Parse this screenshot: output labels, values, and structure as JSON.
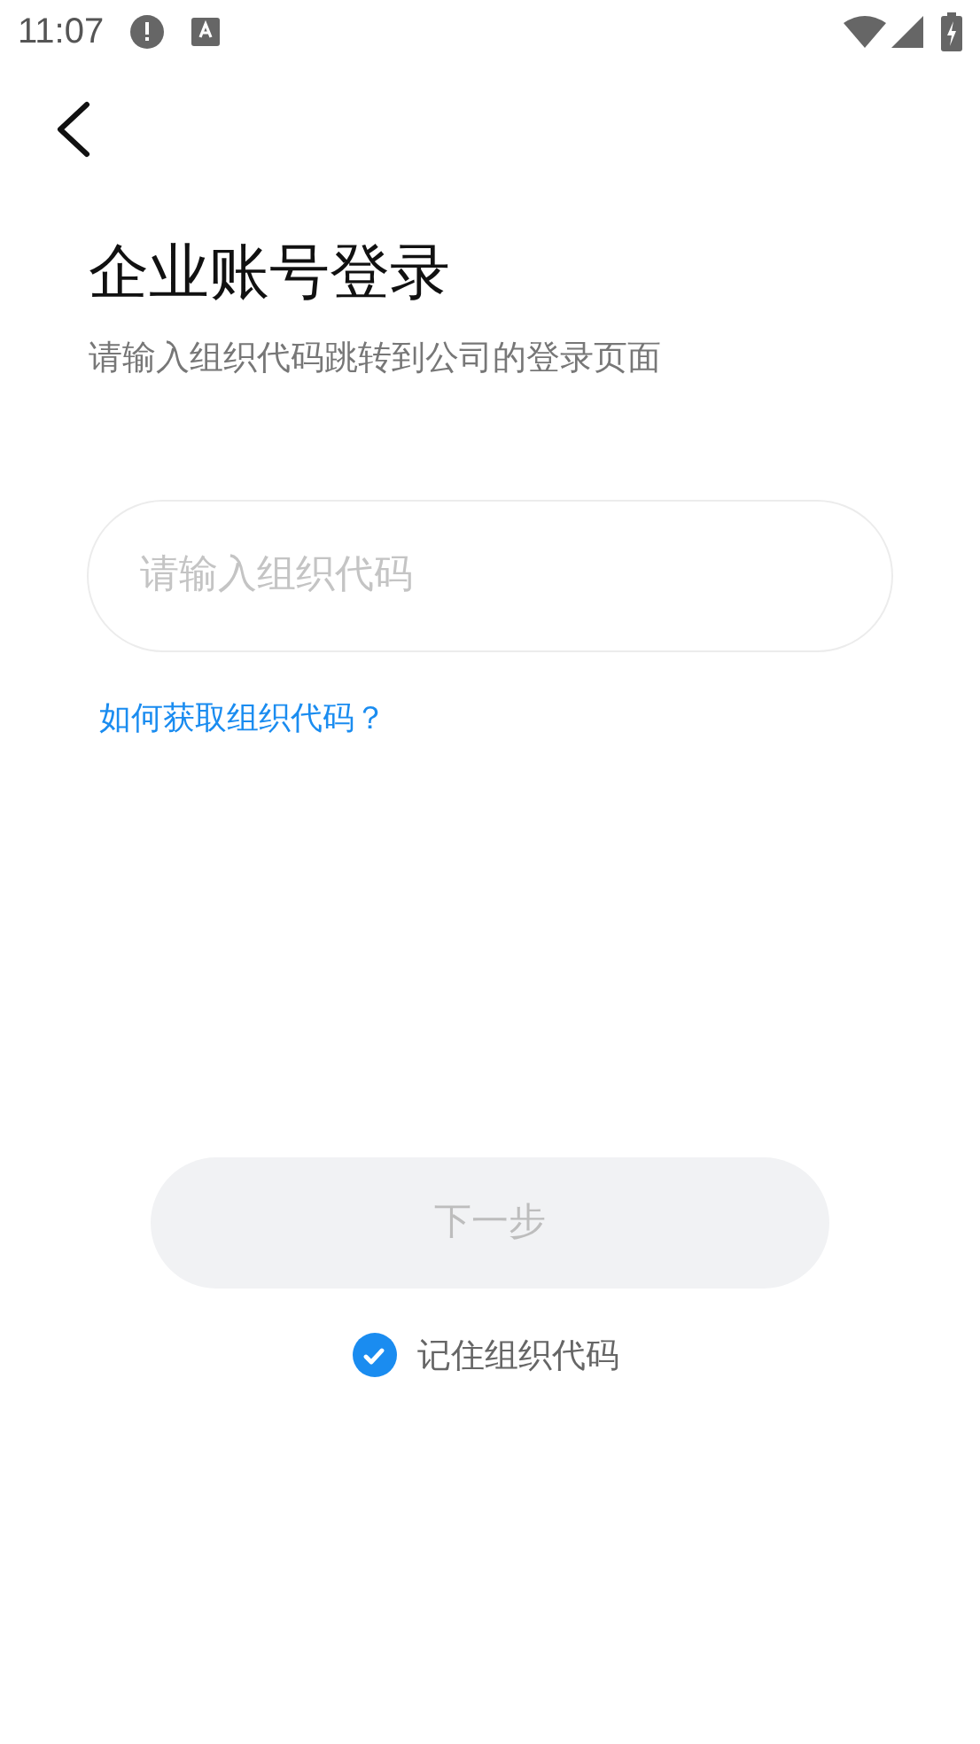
{
  "status_bar": {
    "time": "11:07"
  },
  "title": "企业账号登录",
  "subtitle": "请输入组织代码跳转到公司的登录页面",
  "org_code_field": {
    "placeholder": "请输入组织代码"
  },
  "help_link": "如何获取组织代码？",
  "next_button": {
    "label": "下一步",
    "disabled": true
  },
  "remember": {
    "label": "记住组织代码",
    "checked": true
  }
}
